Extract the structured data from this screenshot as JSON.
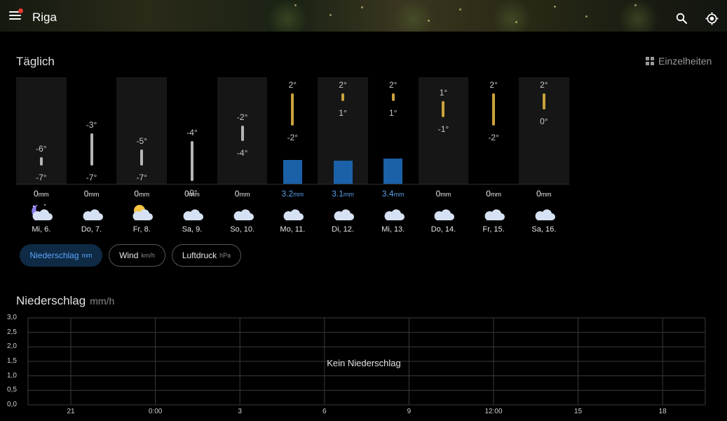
{
  "header": {
    "city": "Riga"
  },
  "daily": {
    "title": "Täglich",
    "details_label": "Einzelheiten",
    "days": [
      {
        "label": "Mi, 6.",
        "high": "-6°",
        "low": "-7°",
        "hi": -6,
        "lo": -7,
        "precip_value": "0",
        "precip": 0,
        "icon": "moon-cloud-icon",
        "shade": true
      },
      {
        "label": "Do, 7.",
        "high": "-3°",
        "low": "-7°",
        "hi": -3,
        "lo": -7,
        "precip_value": "0",
        "precip": 0,
        "icon": "cloud-icon",
        "shade": false
      },
      {
        "label": "Fr, 8.",
        "high": "-5°",
        "low": "-7°",
        "hi": -5,
        "lo": -7,
        "precip_value": "0",
        "precip": 0,
        "icon": "sun-cloud-icon",
        "shade": true
      },
      {
        "label": "Sa, 9.",
        "high": "-4°",
        "low": "-9°",
        "hi": -4,
        "lo": -9,
        "precip_value": "0",
        "precip": 0,
        "icon": "cloud-icon",
        "shade": false
      },
      {
        "label": "So, 10.",
        "high": "-2°",
        "low": "-4°",
        "hi": -2,
        "lo": -4,
        "precip_value": "0",
        "precip": 0,
        "icon": "cloud-icon",
        "shade": true
      },
      {
        "label": "Mo, 11.",
        "high": "2°",
        "low": "-2°",
        "hi": 2,
        "lo": -2,
        "precip_value": "3.2",
        "precip": 3.2,
        "icon": "cloud-icon",
        "shade": false
      },
      {
        "label": "Di, 12.",
        "high": "2°",
        "low": "1°",
        "hi": 2,
        "lo": 1,
        "precip_value": "3.1",
        "precip": 3.1,
        "icon": "cloud-icon",
        "shade": true
      },
      {
        "label": "Mi, 13.",
        "high": "2°",
        "low": "1°",
        "hi": 2,
        "lo": 1,
        "precip_value": "3.4",
        "precip": 3.4,
        "icon": "cloud-icon",
        "shade": false
      },
      {
        "label": "Do, 14.",
        "high": "1°",
        "low": "-1°",
        "hi": 1,
        "lo": -1,
        "precip_value": "0",
        "precip": 0,
        "icon": "cloud-icon",
        "shade": true
      },
      {
        "label": "Fr, 15.",
        "high": "2°",
        "low": "-2°",
        "hi": 2,
        "lo": -2,
        "precip_value": "0",
        "precip": 0,
        "icon": "cloud-icon",
        "shade": false
      },
      {
        "label": "Sa, 16.",
        "high": "2°",
        "low": "0°",
        "hi": 2,
        "lo": 0,
        "precip_value": "0",
        "precip": 0,
        "icon": "cloud-icon",
        "shade": true
      }
    ],
    "precip_unit": "mm"
  },
  "chips": [
    {
      "label": "Niederschlag",
      "unit": "mm",
      "active": true
    },
    {
      "label": "Wind",
      "unit": "km/h",
      "active": false
    },
    {
      "label": "Luftdruck",
      "unit": "hPa",
      "active": false
    }
  ],
  "precip_chart": {
    "title": "Niederschlag",
    "unit": "mm/h",
    "empty_message": "Kein Niederschlag",
    "y_ticks": [
      "3,0",
      "2,5",
      "2,0",
      "1,5",
      "1,0",
      "0,5",
      "0,0"
    ],
    "x_ticks": [
      "21",
      "0:00",
      "3",
      "6",
      "9",
      "12:00",
      "15",
      "18"
    ]
  },
  "colors": {
    "precip_bar": "#1b61a8",
    "precip_blue_text": "#5a9fe8",
    "cold_bar": "#b5b5b5",
    "warm_bar": "#c9a23a",
    "active_chip_bg": "#0f2a44"
  }
}
